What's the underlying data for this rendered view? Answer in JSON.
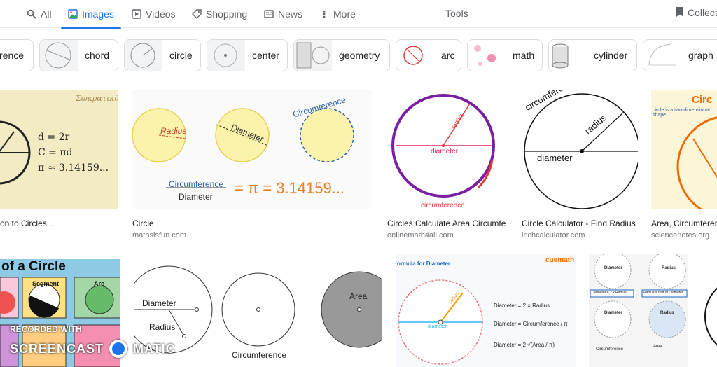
{
  "tabs": [
    {
      "label": "All",
      "icon": "search-icon"
    },
    {
      "label": "Images",
      "icon": "image-icon",
      "active": true
    },
    {
      "label": "Videos",
      "icon": "play-icon"
    },
    {
      "label": "Shopping",
      "icon": "tag-icon"
    },
    {
      "label": "News",
      "icon": "newspaper-icon"
    },
    {
      "label": "More",
      "icon": "more-vert-icon"
    }
  ],
  "tools_label": "Tools",
  "collections_label": "Collections",
  "chips": [
    "rence",
    "chord",
    "circle",
    "center",
    "geometry",
    "arc",
    "math",
    "cylinder",
    "graph"
  ],
  "row1": [
    {
      "title": "on to Circles ...",
      "source": ""
    },
    {
      "title": "Circle",
      "source": "mathsisfun.com"
    },
    {
      "title": "Circles Calculate Area Circumference ...",
      "source": "onlinemath4all.com"
    },
    {
      "title": "Circle Calculator - Find Radius ...",
      "source": "inchcalculator.com"
    },
    {
      "title": "Area, Circumference ...",
      "source": "sciencenotes.org"
    }
  ],
  "img_text": {
    "socratica": "Σωκρατικά",
    "formula_d": "d = 2r",
    "formula_c": "C = πd",
    "formula_pi": "π ≈ 3.14159...",
    "radius": "Radius",
    "diameter": "Diameter",
    "circumference": "Circumference",
    "pi_value": "= π = 3.14159...",
    "radius_lc": "radius",
    "diameter_lc": "diameter",
    "circumference_lc": "circumference",
    "circ_title": "Circ",
    "circ_desc": "circle is a two-dimensional shape...",
    "row2_title": "of a Circle",
    "segment": "Segment",
    "arc": "Arc",
    "area": "Area",
    "formula_for_diameter": "ormula for Diameter",
    "cuemath": "cuemath",
    "f1": "Diameter = 2 × Radius",
    "f2": "Diameter = Circumference / π",
    "f3": "Diameter = 2 √(Area / π)",
    "diam_eq": "Diameter = 2 x Radius",
    "rad_eq": "Radius = half of Diameter",
    "circ_eq": "Circumference",
    "area_eq": "Area"
  },
  "watermark": {
    "line1": "RECORDED WITH",
    "line2a": "SCREENCAST",
    "line2b": "MATIC"
  }
}
